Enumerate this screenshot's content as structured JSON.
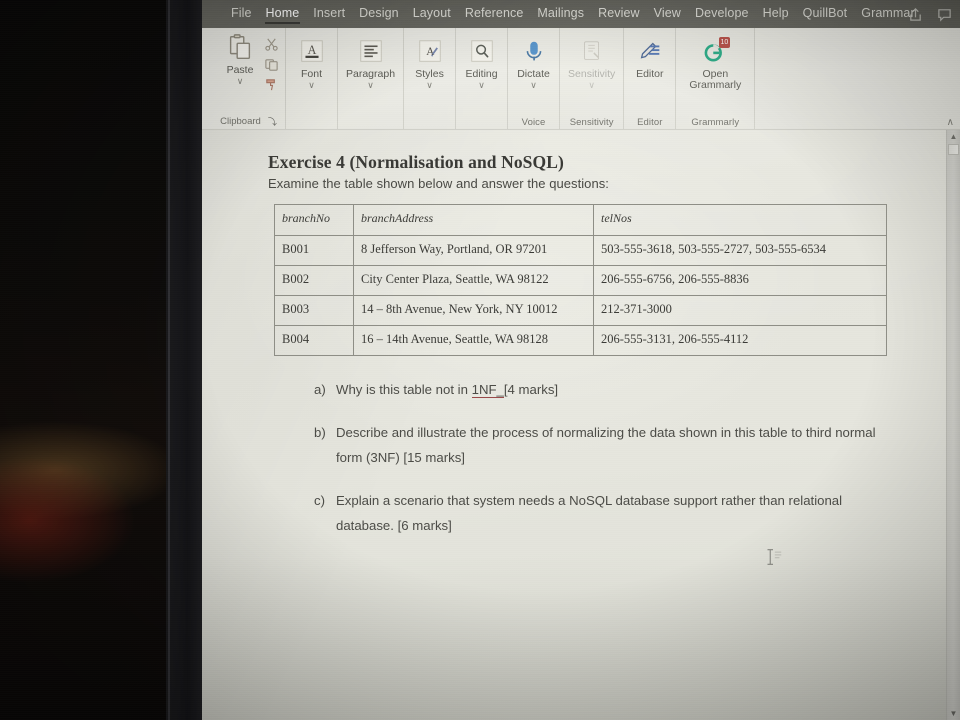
{
  "app": {
    "tabs": [
      {
        "label": "File",
        "active": false
      },
      {
        "label": "Home",
        "active": true
      },
      {
        "label": "Insert",
        "active": false
      },
      {
        "label": "Design",
        "active": false
      },
      {
        "label": "Layout",
        "active": false
      },
      {
        "label": "Referencе",
        "active": false
      },
      {
        "label": "Mailings",
        "active": false
      },
      {
        "label": "Review",
        "active": false
      },
      {
        "label": "View",
        "active": false
      },
      {
        "label": "Develope",
        "active": false
      },
      {
        "label": "Help",
        "active": false
      },
      {
        "label": "QuillBot",
        "active": false
      },
      {
        "label": "Grammar",
        "active": false
      }
    ],
    "titlebar_icons": [
      {
        "name": "share-icon"
      },
      {
        "name": "comments-icon"
      }
    ],
    "ribbon": {
      "collapse_chevron": "∧",
      "groups": [
        {
          "name": "clipboard",
          "label": "Clipboard",
          "launcher": "⤵",
          "main_button": {
            "label": "Paste",
            "chevron": "∨",
            "icon": "paste-icon"
          },
          "side_buttons": [
            {
              "label": "Cut",
              "icon": "scissors-icon"
            },
            {
              "label": "Copy",
              "icon": "copy-icon"
            },
            {
              "label": "Format Painter",
              "icon": "format-painter-icon"
            }
          ]
        },
        {
          "name": "font",
          "label": "",
          "button": {
            "label": "Font",
            "chevron": "∨",
            "icon": "font-icon"
          }
        },
        {
          "name": "paragraph",
          "label": "",
          "button": {
            "label": "Paragraph",
            "chevron": "∨",
            "icon": "paragraph-icon"
          }
        },
        {
          "name": "styles",
          "label": "",
          "button": {
            "label": "Styles",
            "chevron": "∨",
            "icon": "styles-icon"
          }
        },
        {
          "name": "editing",
          "label": "",
          "button": {
            "label": "Editing",
            "chevron": "∨",
            "icon": "find-icon"
          }
        },
        {
          "name": "voice",
          "label": "Voice",
          "button": {
            "label": "Dictate",
            "chevron": "∨",
            "icon": "microphone-icon"
          }
        },
        {
          "name": "sensitivity",
          "label": "Sensitivity",
          "button": {
            "label": "Sensitivity",
            "chevron": "∨",
            "icon": "sensitivity-icon",
            "disabled": true
          }
        },
        {
          "name": "editor",
          "label": "Editor",
          "button": {
            "label": "Editor",
            "chevron": "",
            "icon": "editor-pen-icon"
          }
        },
        {
          "name": "grammarly",
          "label": "Grammarly",
          "button": {
            "label": "Open Grammarly",
            "chevron": "",
            "icon": "grammarly-icon",
            "badge": "10"
          }
        }
      ]
    }
  },
  "document": {
    "title": "Exercise 4 (Normalisation and NoSQL)",
    "subtitle": "Examine the table shown below and answer the questions:",
    "table": {
      "headers": [
        "branchNo",
        "branchAddress",
        "telNos"
      ],
      "rows": [
        [
          "B001",
          "8 Jefferson Way, Portland, OR 97201",
          "503-555-3618, 503-555-2727, 503-555-6534"
        ],
        [
          "B002",
          "City Center Plaza, Seattle, WA 98122",
          "206-555-6756, 206-555-8836"
        ],
        [
          "B003",
          "14 – 8th Avenue, New York, NY 10012",
          "212-371-3000"
        ],
        [
          "B004",
          "16 – 14th Avenue, Seattle, WA 98128",
          "206-555-3131, 206-555-4112"
        ]
      ]
    },
    "questions": [
      {
        "marker": "a)",
        "parts": [
          {
            "text": "Why is this table not in ",
            "style": "plain"
          },
          {
            "text": "1NF_",
            "style": "spellcheck"
          },
          {
            "text": "[4 marks]",
            "style": "plain"
          }
        ]
      },
      {
        "marker": "b)",
        "parts": [
          {
            "text": "Describe and illustrate the process of normalizing the data shown in this table to third normal form (3NF) [15 marks]",
            "style": "plain"
          }
        ]
      },
      {
        "marker": "c)",
        "parts": [
          {
            "text": "Explain a scenario that system needs a NoSQL database support rather than relational database. [6 marks]",
            "style": "plain"
          }
        ]
      }
    ]
  },
  "scrollbar": {
    "up_arrow": "▲",
    "down_arrow": "▼"
  },
  "colors": {
    "ribbon_bg": "#ecece5",
    "tabstrip_bg": "#5b5b54",
    "page_bg": "#e6e6de",
    "text": "#4c4c47",
    "table_border": "#8e8e86",
    "accent_grammarly": "#15c39a",
    "accent_badge": "#b3443c",
    "spellcheck_underline": "#9a4a4a"
  }
}
